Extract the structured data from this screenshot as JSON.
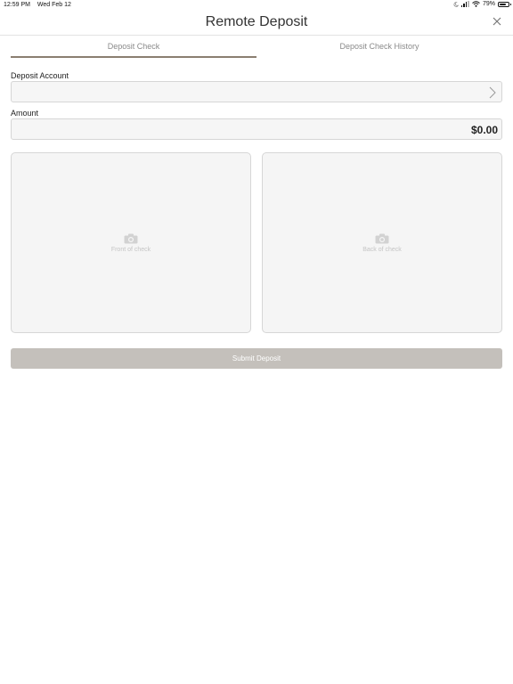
{
  "status_bar": {
    "time": "12:59 PM",
    "date": "Wed Feb 12",
    "battery_level": "79%",
    "battery_fraction": 0.79
  },
  "header": {
    "title": "Remote Deposit"
  },
  "tabs": [
    {
      "label": "Deposit Check",
      "active": true
    },
    {
      "label": "Deposit Check History",
      "active": false
    }
  ],
  "form": {
    "deposit_account_label": "Deposit Account",
    "deposit_account_value": "",
    "amount_label": "Amount",
    "amount_value": "$0.00"
  },
  "check_images": {
    "front_caption": "Front of check",
    "back_caption": "Back of check"
  },
  "submit_label": "Submit Deposit",
  "colors": {
    "tab_indicator": "#8b7f70",
    "submit_disabled": "#c4c0bb"
  },
  "icons": [
    "moon-icon",
    "signal-icon",
    "wifi-icon",
    "battery-icon",
    "close-icon",
    "chevron-right-icon",
    "camera-icon"
  ]
}
